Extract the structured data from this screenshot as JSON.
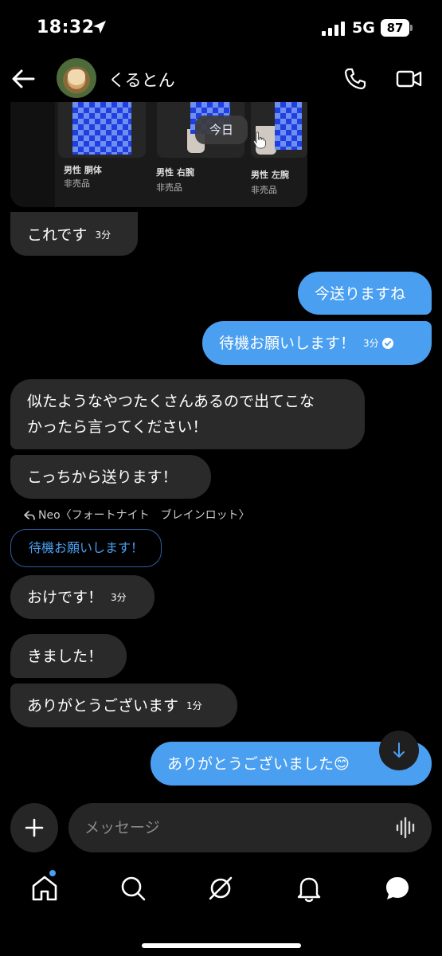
{
  "status_bar": {
    "time": "18:32",
    "network": "5G",
    "battery": "87"
  },
  "header": {
    "contact_name": "くるとん"
  },
  "image_card": {
    "items": [
      {
        "name": "男性 胴体",
        "status": "非売品"
      },
      {
        "name": "男性 右腕",
        "status": "非売品"
      },
      {
        "name": "男性 左腕",
        "status": "非売品"
      }
    ],
    "date_chip": "今日"
  },
  "messages": [
    {
      "text": "これです",
      "time": "3分"
    },
    {
      "text": "今送りますね"
    },
    {
      "text": "待機お願いします！",
      "time": "3分"
    },
    {
      "text_line1": "似たようなやつたくさんあるので出てこな",
      "text_line2": "かったら言ってください！"
    },
    {
      "text": "こっちから送ります！"
    },
    {
      "reply_to": "Neo〈フォートナイト　ブレインロット〉",
      "quoted": "待機お願いします！"
    },
    {
      "text": "おけです！",
      "time": "3分"
    },
    {
      "text": "きました！"
    },
    {
      "text": "ありがとうございます",
      "time": "1分"
    },
    {
      "text": "ありがとうございました😊"
    }
  ],
  "composer": {
    "placeholder": "メッセージ"
  },
  "colors": {
    "accent": "#4a9ff0",
    "incoming_bubble": "#2a2a2a",
    "background": "#000000"
  }
}
